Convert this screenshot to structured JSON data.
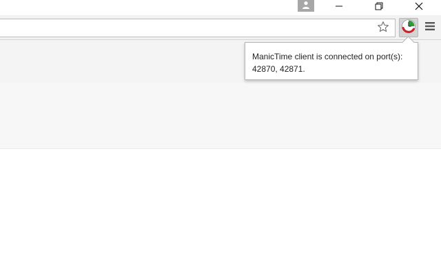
{
  "window": {
    "profile_icon": "person-icon",
    "minimize_icon": "minimize-icon",
    "restore_icon": "restore-icon",
    "close_icon": "close-icon"
  },
  "toolbar": {
    "address_value": "",
    "bookmark_icon": "star-icon",
    "extension_icon": "manictime-icon",
    "menu_icon": "hamburger-menu-icon"
  },
  "popup": {
    "line1": "ManicTime client is connected on port(s):",
    "line2": "42870, 42871."
  },
  "colors": {
    "extension_green": "#2e9b3a",
    "extension_red": "#c8232c"
  }
}
